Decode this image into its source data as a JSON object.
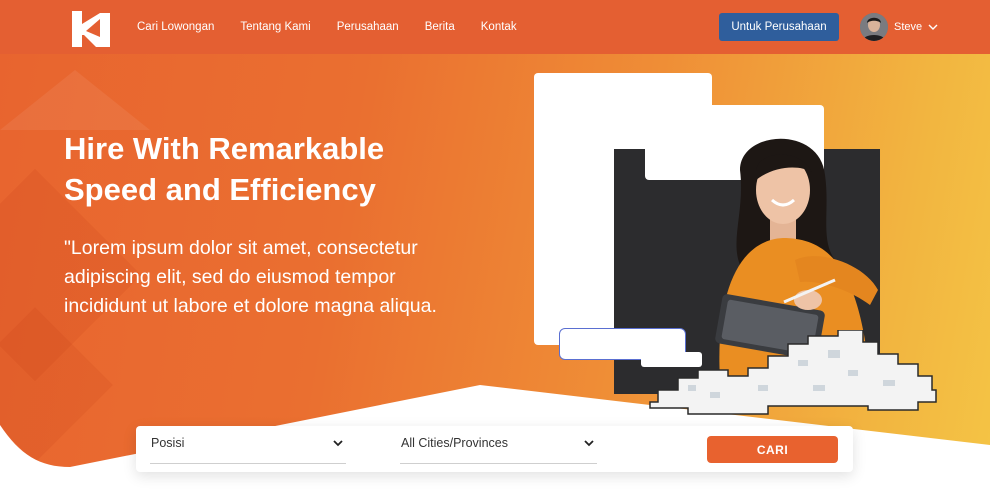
{
  "brand": {
    "logo_icon": "h-logo-icon",
    "accent_color": "#e45f32",
    "nav_button_color": "#2f5e9c"
  },
  "nav": {
    "links": [
      "Cari Lowongan",
      "Tentang Kami",
      "Perusahaan",
      "Berita",
      "Kontak"
    ],
    "company_button": "Untuk Perusahaan",
    "user_name": "Steve",
    "user_chevron_icon": "chevron-down-icon"
  },
  "hero": {
    "title_line1": "Hire With Remarkable",
    "title_line2": "Speed and Efficiency",
    "desc_line1": "\"Lorem ipsum dolor sit amet, consectetur",
    "desc_line2": "adipiscing elit, sed do eiusmod tempor",
    "desc_line3": "incididunt ut labore et dolore magna aliqua."
  },
  "search": {
    "position_value": "Posisi",
    "city_value": "All Cities/Provinces",
    "submit_label": "CARI"
  }
}
